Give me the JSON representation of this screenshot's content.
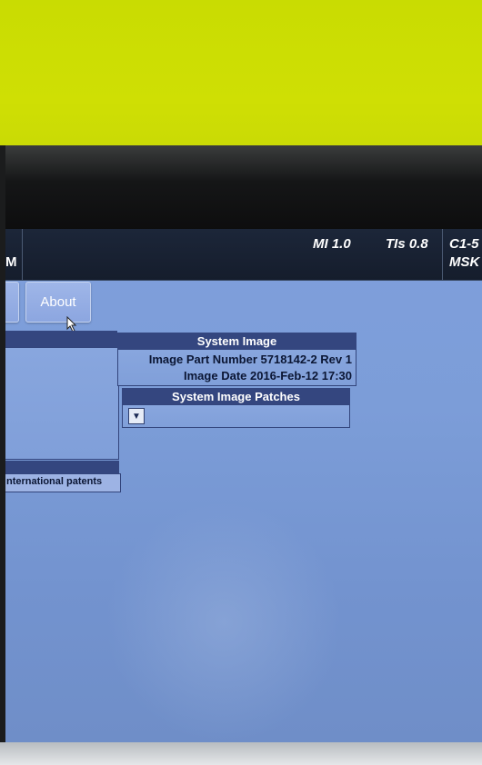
{
  "status_bar": {
    "left_fragment": "M",
    "mi": "MI 1.0",
    "tis": "TIs 0.8",
    "probe": "C1-5",
    "preset": "MSK"
  },
  "toolbar": {
    "about_label": "About"
  },
  "left_panel": {
    "footer_text": "nternational patents"
  },
  "system_image": {
    "title": "System Image",
    "part_number": "Image Part Number 5718142-2 Rev 1",
    "image_date": "Image Date 2016-Feb-12 17:30"
  },
  "patches": {
    "title": "System Image Patches",
    "dropdown_icon": "chevron-down-icon"
  },
  "colors": {
    "wall": "#cfdf04",
    "screen_bg": "#7f9fdc",
    "header_bg": "#34467f",
    "statusbar_bg": "#1c2639"
  }
}
